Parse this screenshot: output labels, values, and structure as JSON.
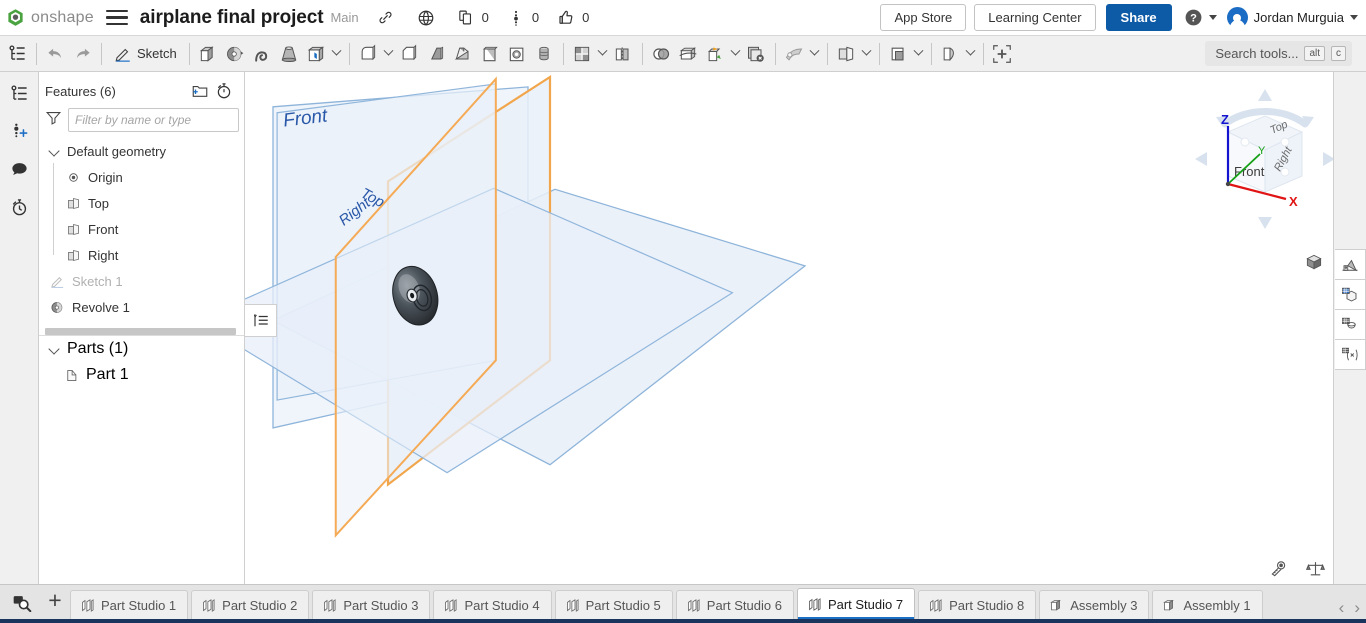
{
  "topbar": {
    "logo_text": "onshape",
    "logo_icon": "onshape-logo-icon",
    "menu_icon": "hamburger-menu-icon",
    "doc_title": "airplane final project",
    "branch": "Main",
    "link_icon": "link-icon",
    "globe_icon": "globe-icon",
    "copies_icon": "copy-icon",
    "copies_count": "0",
    "versions_icon": "branch-icon",
    "versions_count": "0",
    "likes_icon": "thumbs-up-icon",
    "likes_count": "0",
    "app_store": "App Store",
    "learning_center": "Learning Center",
    "share": "Share",
    "help_icon": "help-circle-icon",
    "user_name": "Jordan Murguia",
    "avatar_icon": "user-avatar",
    "share_color": "#0d5aa7"
  },
  "toolbar": {
    "feature_tree_icon": "feature-tree-icon",
    "undo_icon": "undo-arrow-icon",
    "redo_icon": "redo-arrow-icon",
    "sketch_label": "Sketch",
    "sketch_icon": "sketch-pencil-icon",
    "tools": [
      {
        "name": "extrude-icon"
      },
      {
        "name": "revolve-icon"
      },
      {
        "name": "sweep-icon"
      },
      {
        "name": "loft-icon"
      },
      {
        "name": "thicken-icon"
      },
      {
        "name": "fillet-icon"
      },
      {
        "name": "chamfer-icon"
      },
      {
        "name": "draft-icon"
      },
      {
        "name": "rib-icon"
      },
      {
        "name": "shell-icon"
      },
      {
        "name": "hole-icon"
      },
      {
        "name": "pattern-icon"
      },
      {
        "name": "mirror-icon"
      },
      {
        "name": "boolean-icon"
      },
      {
        "name": "split-icon"
      },
      {
        "name": "transform-icon"
      },
      {
        "name": "delete-face-icon"
      },
      {
        "name": "sheet-metal-icon"
      },
      {
        "name": "plane-icon"
      },
      {
        "name": "derive-icon"
      },
      {
        "name": "curve-icon"
      },
      {
        "name": "insert-icon"
      }
    ],
    "search_placeholder": "Search tools...",
    "kbd_alt": "alt",
    "kbd_c": "c"
  },
  "leftrail": {
    "items": [
      {
        "name": "feature-list-icon"
      },
      {
        "name": "add-version-icon"
      },
      {
        "name": "comments-icon"
      },
      {
        "name": "history-icon"
      }
    ]
  },
  "panel": {
    "title": "Features (6)",
    "folder_icon": "new-folder-icon",
    "rollback_icon": "rollback-stopwatch-icon",
    "filter_icon": "filter-funnel-icon",
    "filter_placeholder": "Filter by name or type",
    "rollback_button_icon": "feature-list-toggle-icon",
    "default_geometry": "Default geometry",
    "features": [
      {
        "label": "Origin",
        "icon": "origin-icon",
        "state": "normal"
      },
      {
        "label": "Top",
        "icon": "plane-icon",
        "state": "normal"
      },
      {
        "label": "Front",
        "icon": "plane-icon",
        "state": "normal"
      },
      {
        "label": "Right",
        "icon": "plane-icon",
        "state": "normal"
      },
      {
        "label": "Sketch 1",
        "icon": "sketch-pencil-icon",
        "state": "muted"
      },
      {
        "label": "Revolve 1",
        "icon": "revolve-icon",
        "state": "normal"
      }
    ],
    "parts_title": "Parts (1)",
    "parts": [
      {
        "label": "Part 1",
        "icon": "part-icon"
      }
    ]
  },
  "viewport": {
    "planes": [
      {
        "label": "Front",
        "color": "#7aa3d0",
        "highlighted": false
      },
      {
        "label": "Top",
        "color": "#7aa3d0",
        "highlighted": false
      },
      {
        "label": "Right",
        "color": "#f5a94e",
        "highlighted": true
      }
    ],
    "part_color": "#3b4147",
    "viewcube": {
      "faces": {
        "top": "Top",
        "front": "Front",
        "right": "Right"
      },
      "axes": [
        {
          "label": "Z",
          "color": "#1414d0"
        },
        {
          "label": "Y",
          "color": "#14a014"
        },
        {
          "label": "X",
          "color": "#e01414"
        }
      ]
    },
    "view_style_icon": "shaded-cube-icon",
    "right_panels": [
      {
        "name": "appearance-panel-icon"
      },
      {
        "name": "display-state-panel-icon"
      },
      {
        "name": "render-panel-icon"
      },
      {
        "name": "variables-panel-icon"
      }
    ],
    "bottom_tools": [
      {
        "name": "measure-tape-icon"
      },
      {
        "name": "mass-properties-icon"
      }
    ]
  },
  "tabbar": {
    "search_tabs_icon": "tab-search-icon",
    "add_tab_icon": "add-tab-icon",
    "tabs": [
      {
        "label": "Part Studio 1",
        "icon": "part-studio-icon",
        "active": false
      },
      {
        "label": "Part Studio 2",
        "icon": "part-studio-icon",
        "active": false
      },
      {
        "label": "Part Studio 3",
        "icon": "part-studio-icon",
        "active": false
      },
      {
        "label": "Part Studio 4",
        "icon": "part-studio-icon",
        "active": false
      },
      {
        "label": "Part Studio 5",
        "icon": "part-studio-icon",
        "active": false
      },
      {
        "label": "Part Studio 6",
        "icon": "part-studio-icon",
        "active": false
      },
      {
        "label": "Part Studio 7",
        "icon": "part-studio-icon",
        "active": true
      },
      {
        "label": "Part Studio 8",
        "icon": "part-studio-icon",
        "active": false
      },
      {
        "label": "Assembly 3",
        "icon": "assembly-icon",
        "active": false
      },
      {
        "label": "Assembly 1",
        "icon": "assembly-icon",
        "active": false
      }
    ],
    "prev_label": "‹",
    "next_label": "›"
  }
}
